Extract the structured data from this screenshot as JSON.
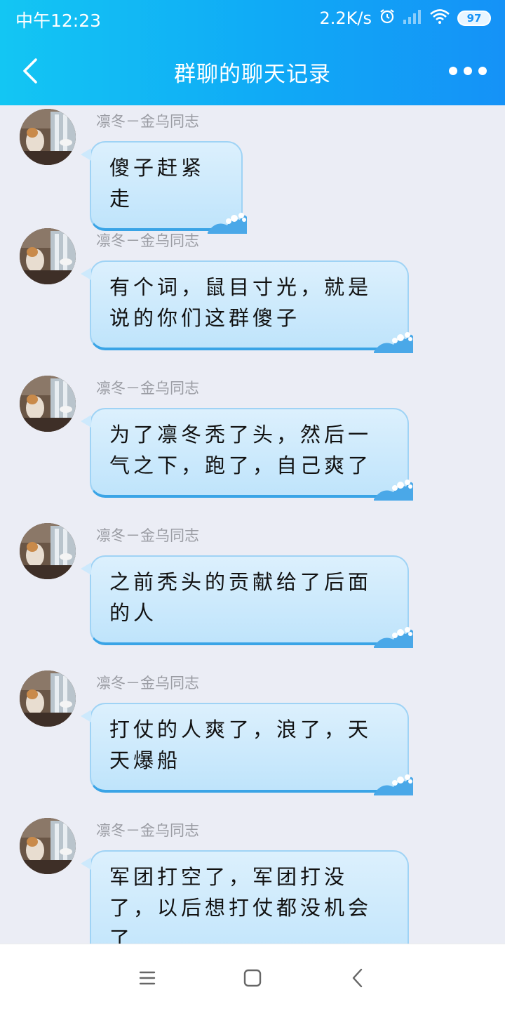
{
  "status_bar": {
    "time": "中午12:23",
    "net_speed": "2.2K/s",
    "battery": "97"
  },
  "nav": {
    "title": "群聊的聊天记录"
  },
  "messages": [
    {
      "sender": "凛冬－金乌同志",
      "text": "傻子赶紧走"
    },
    {
      "sender": "凛冬－金乌同志",
      "text": "有个词，鼠目寸光，就是说的你们这群傻子"
    },
    {
      "sender": "凛冬－金乌同志",
      "text": "为了凛冬秃了头，然后一气之下，跑了，自己爽了"
    },
    {
      "sender": "凛冬－金乌同志",
      "text": "之前秃头的贡献给了后面的人"
    },
    {
      "sender": "凛冬－金乌同志",
      "text": "打仗的人爽了，浪了，天天爆船"
    },
    {
      "sender": "凛冬－金乌同志",
      "text": "军团打空了，军团打没了，以后想打仗都没机会了"
    }
  ],
  "colors": {
    "header_start": "#13c6f3",
    "header_end": "#1592f7",
    "page_bg": "#ebedf5",
    "bubble_top": "#dcf0fd",
    "bubble_bottom": "#bfe4fb"
  },
  "icons": {
    "back": "chevron-left-icon",
    "more": "more-dots-icon",
    "alarm": "alarm-clock-icon",
    "signal": "signal-icon",
    "wifi": "wifi-icon",
    "menu": "menu-lines-icon",
    "home": "home-square-icon",
    "system_back": "system-back-icon"
  }
}
